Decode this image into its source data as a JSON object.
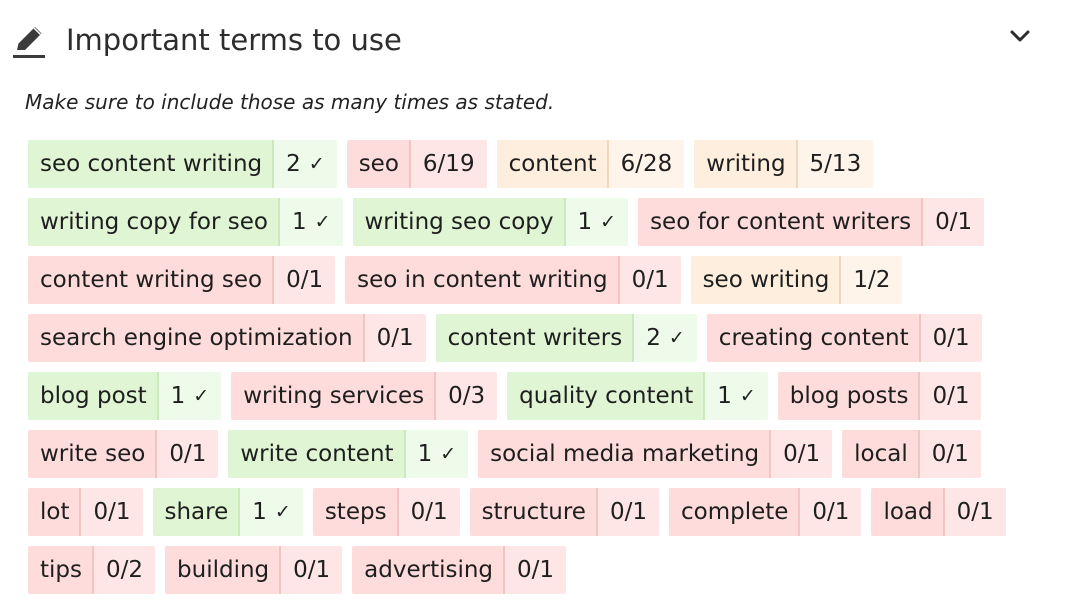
{
  "header": {
    "title": "Important terms to use",
    "icon": "pencil-icon",
    "collapse_icon": "chevron-down-icon"
  },
  "subtitle": "Make sure to include those as many times as stated.",
  "colors": {
    "done": "#dff5d4",
    "missing": "#fddcdb",
    "partial": "#fdeedd"
  },
  "terms": [
    {
      "term": "seo content writing",
      "count": "2",
      "check": "✓",
      "status": "done"
    },
    {
      "term": "seo",
      "count": "6/19",
      "check": "",
      "status": "missing"
    },
    {
      "term": "content",
      "count": "6/28",
      "check": "",
      "status": "partial"
    },
    {
      "term": "writing",
      "count": "5/13",
      "check": "",
      "status": "partial"
    },
    {
      "term": "writing copy for seo",
      "count": "1",
      "check": "✓",
      "status": "done"
    },
    {
      "term": "writing seo copy",
      "count": "1",
      "check": "✓",
      "status": "done"
    },
    {
      "term": "seo for content writers",
      "count": "0/1",
      "check": "",
      "status": "missing"
    },
    {
      "term": "content writing seo",
      "count": "0/1",
      "check": "",
      "status": "missing"
    },
    {
      "term": "seo in content writing",
      "count": "0/1",
      "check": "",
      "status": "missing"
    },
    {
      "term": "seo writing",
      "count": "1/2",
      "check": "",
      "status": "partial"
    },
    {
      "term": "search engine optimization",
      "count": "0/1",
      "check": "",
      "status": "missing"
    },
    {
      "term": "content writers",
      "count": "2",
      "check": "✓",
      "status": "done"
    },
    {
      "term": "creating content",
      "count": "0/1",
      "check": "",
      "status": "missing"
    },
    {
      "term": "blog post",
      "count": "1",
      "check": "✓",
      "status": "done"
    },
    {
      "term": "writing services",
      "count": "0/3",
      "check": "",
      "status": "missing"
    },
    {
      "term": "quality content",
      "count": "1",
      "check": "✓",
      "status": "done"
    },
    {
      "term": "blog posts",
      "count": "0/1",
      "check": "",
      "status": "missing"
    },
    {
      "term": "write seo",
      "count": "0/1",
      "check": "",
      "status": "missing"
    },
    {
      "term": "write content",
      "count": "1",
      "check": "✓",
      "status": "done"
    },
    {
      "term": "social media marketing",
      "count": "0/1",
      "check": "",
      "status": "missing"
    },
    {
      "term": "local",
      "count": "0/1",
      "check": "",
      "status": "missing"
    },
    {
      "term": "lot",
      "count": "0/1",
      "check": "",
      "status": "missing"
    },
    {
      "term": "share",
      "count": "1",
      "check": "✓",
      "status": "done"
    },
    {
      "term": "steps",
      "count": "0/1",
      "check": "",
      "status": "missing"
    },
    {
      "term": "structure",
      "count": "0/1",
      "check": "",
      "status": "missing"
    },
    {
      "term": "complete",
      "count": "0/1",
      "check": "",
      "status": "missing"
    },
    {
      "term": "load",
      "count": "0/1",
      "check": "",
      "status": "missing"
    },
    {
      "term": "tips",
      "count": "0/2",
      "check": "",
      "status": "missing"
    },
    {
      "term": "building",
      "count": "0/1",
      "check": "",
      "status": "missing"
    },
    {
      "term": "advertising",
      "count": "0/1",
      "check": "",
      "status": "missing"
    }
  ]
}
